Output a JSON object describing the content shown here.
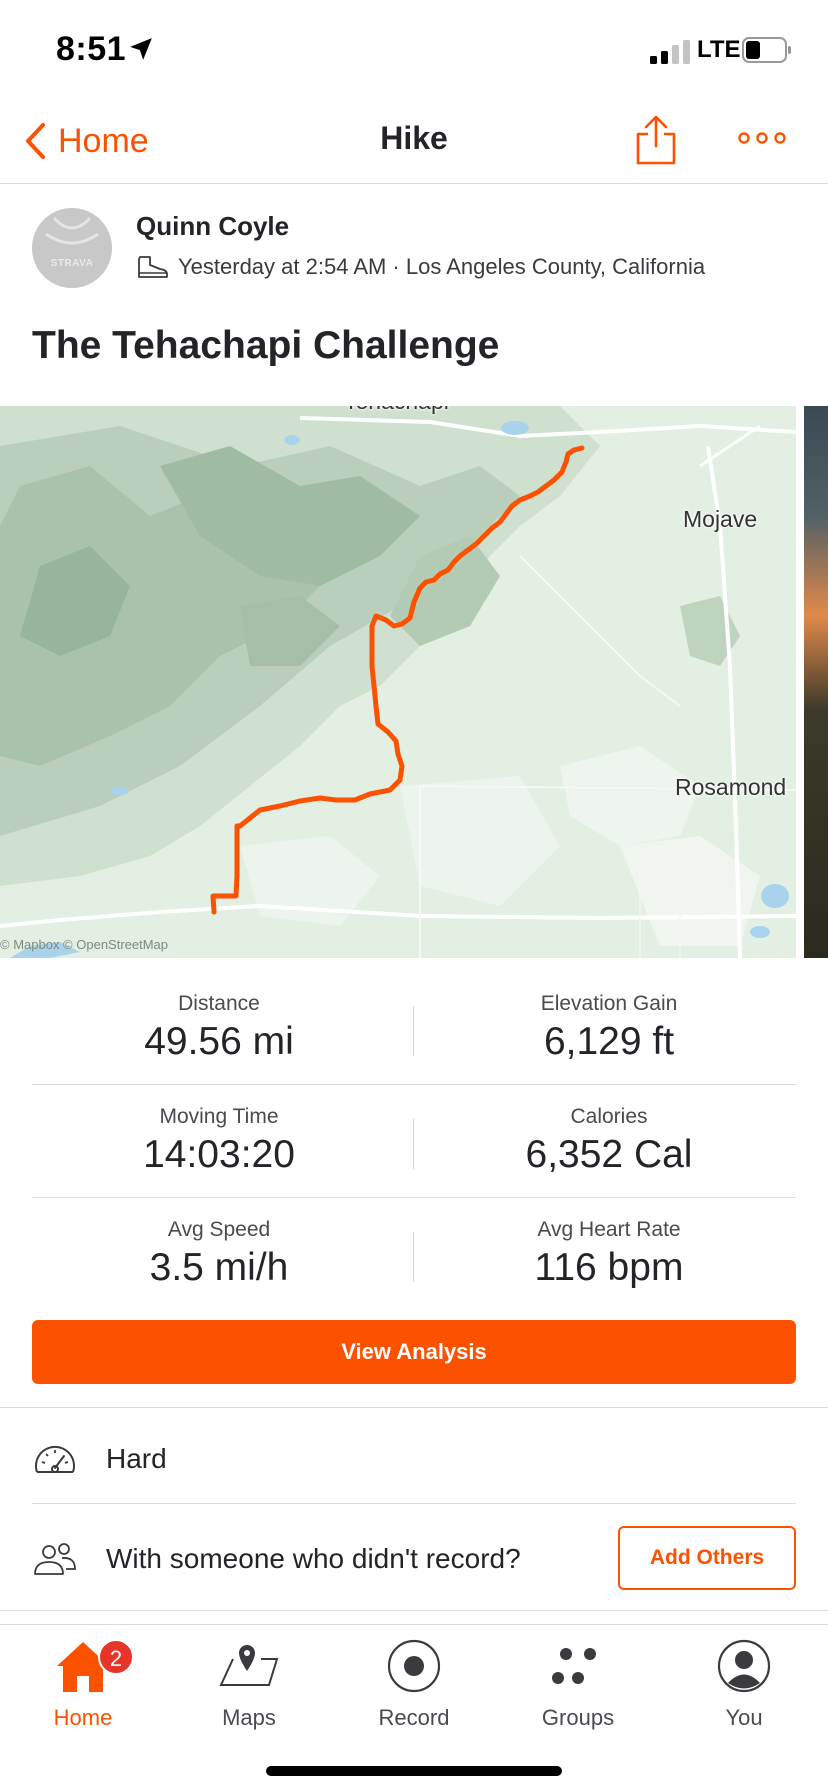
{
  "status_bar": {
    "time": "8:51",
    "network": "LTE",
    "battery_icon": "battery-low-icon"
  },
  "header": {
    "back_label": "Home",
    "title": "Hike",
    "share_icon": "share-icon",
    "more_icon": "more-dots-icon"
  },
  "accent_color": "#fc5200",
  "athlete": {
    "avatar_text": "STRAVA",
    "name": "Quinn Coyle",
    "meta": "Yesterday at 2:54 AM · Los Angeles County, California",
    "sport_icon": "hiking-boot-icon"
  },
  "activity": {
    "title": "The Tehachapi Challenge"
  },
  "map": {
    "labels": {
      "top_town": "Tehachapi",
      "right_town_1": "Mojave",
      "right_town_2": "Rosamond"
    },
    "attribution": "© Mapbox © OpenStreetMap",
    "route_color": "#fc5200"
  },
  "stats": [
    {
      "label": "Distance",
      "value": "49.56 mi"
    },
    {
      "label": "Elevation Gain",
      "value": "6,129 ft"
    },
    {
      "label": "Moving Time",
      "value": "14:03:20"
    },
    {
      "label": "Calories",
      "value": "6,352 Cal"
    },
    {
      "label": "Avg Speed",
      "value": "3.5 mi/h"
    },
    {
      "label": "Avg Heart Rate",
      "value": "116 bpm"
    }
  ],
  "view_analysis_label": "View Analysis",
  "effort": {
    "icon": "speedometer-icon",
    "label": "Hard"
  },
  "with_others": {
    "icon": "people-icon",
    "label": "With someone who didn't record?",
    "button": "Add Others"
  },
  "tabbar": {
    "items": [
      {
        "label": "Home",
        "icon": "home-icon",
        "badge": "2",
        "active": true
      },
      {
        "label": "Maps",
        "icon": "map-icon"
      },
      {
        "label": "Record",
        "icon": "record-icon"
      },
      {
        "label": "Groups",
        "icon": "groups-icon"
      },
      {
        "label": "You",
        "icon": "profile-icon"
      }
    ]
  }
}
